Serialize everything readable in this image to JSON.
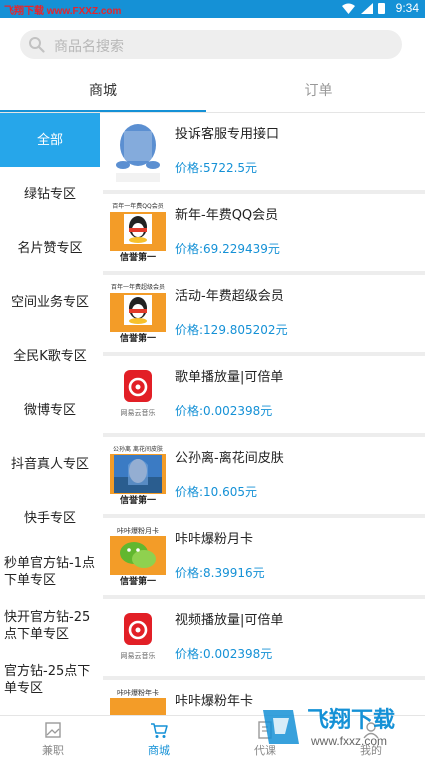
{
  "status_bar": {
    "watermark": "飞翔下载 www.FXXZ.com",
    "time": "9:34"
  },
  "search": {
    "placeholder": "商品名搜索"
  },
  "tabs": [
    {
      "label": "商城"
    },
    {
      "label": "订单"
    }
  ],
  "sidebar": {
    "items": [
      {
        "label": "全部"
      },
      {
        "label": "绿钻专区"
      },
      {
        "label": "名片赞专区"
      },
      {
        "label": "空间业务专区"
      },
      {
        "label": "全民K歌专区"
      },
      {
        "label": "微博专区"
      },
      {
        "label": "抖音真人专区"
      },
      {
        "label": "快手专区"
      },
      {
        "label": "秒单官方钻-1点下单专区"
      },
      {
        "label": "快开官方钻-25点下单专区"
      },
      {
        "label": "官方钻-25点下单专区"
      }
    ]
  },
  "products": [
    {
      "name": "投诉客服专用接口",
      "price": "价格:5722.5元",
      "thumb": "qq-penguin"
    },
    {
      "name": "新年-年费QQ会员",
      "price": "价格:69.229439元",
      "thumb": "qq-member",
      "thumb_top": "百年一年费QQ会员",
      "thumb_bottom": "信誉第一"
    },
    {
      "name": "活动-年费超级会员",
      "price": "价格:129.805202元",
      "thumb": "qq-member",
      "thumb_top": "百年一年费超级会员",
      "thumb_bottom": "信誉第一"
    },
    {
      "name": "歌单播放量|可倍单",
      "price": "价格:0.002398元",
      "thumb": "netease",
      "thumb_caption": "网易云音乐"
    },
    {
      "name": "公孙离-离花间皮肤",
      "price": "价格:10.605元",
      "thumb": "game-skin",
      "thumb_top": "公孙离 离花间皮肤",
      "thumb_bottom": "信誉第一"
    },
    {
      "name": "咔咔爆粉月卡",
      "price": "价格:8.39916元",
      "thumb": "wechat",
      "thumb_top": "咔咔爆粉月卡",
      "thumb_bottom": "信誉第一"
    },
    {
      "name": "视频播放量|可倍单",
      "price": "价格:0.002398元",
      "thumb": "netease",
      "thumb_caption": "网易云音乐"
    },
    {
      "name": "咔咔爆粉年卡",
      "price": "",
      "thumb": "wechat",
      "thumb_top": "咔咔爆粉年卡"
    }
  ],
  "bottom_nav": [
    {
      "label": "兼职",
      "icon": "image-icon"
    },
    {
      "label": "商城",
      "icon": "cart-icon"
    },
    {
      "label": "代课",
      "icon": "doc-icon"
    },
    {
      "label": "我的",
      "icon": "user-icon"
    }
  ],
  "watermark_logo": {
    "title": "飞翔下载",
    "url": "www.fxxz.com"
  },
  "colors": {
    "accent": "#1591d6",
    "active_side": "#26a6ea",
    "price": "#1591d6"
  }
}
